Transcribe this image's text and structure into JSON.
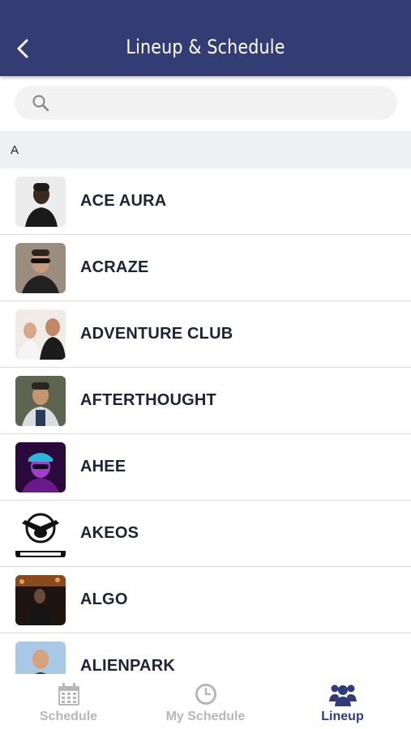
{
  "header": {
    "title": "Lineup & Schedule",
    "back_icon": "chevron-left-icon"
  },
  "search": {
    "placeholder": "",
    "value": "",
    "icon": "search-icon"
  },
  "section": {
    "letter": "A"
  },
  "artists": [
    {
      "name": "ACE AURA"
    },
    {
      "name": "ACRAZE"
    },
    {
      "name": "ADVENTURE CLUB"
    },
    {
      "name": "AFTERTHOUGHT"
    },
    {
      "name": "AHEE"
    },
    {
      "name": "AKEOS"
    },
    {
      "name": "ALGO"
    },
    {
      "name": "ALIENPARK"
    }
  ],
  "tabs": [
    {
      "label": "Schedule",
      "icon": "calendar-icon",
      "active": false
    },
    {
      "label": "My Schedule",
      "icon": "clock-icon",
      "active": false
    },
    {
      "label": "Lineup",
      "icon": "users-icon",
      "active": true
    }
  ],
  "colors": {
    "header_bg": "#333d73",
    "active_tab": "#2f3b7a",
    "inactive_tab": "#b7b7b7",
    "section_bg": "#eff0f2"
  }
}
